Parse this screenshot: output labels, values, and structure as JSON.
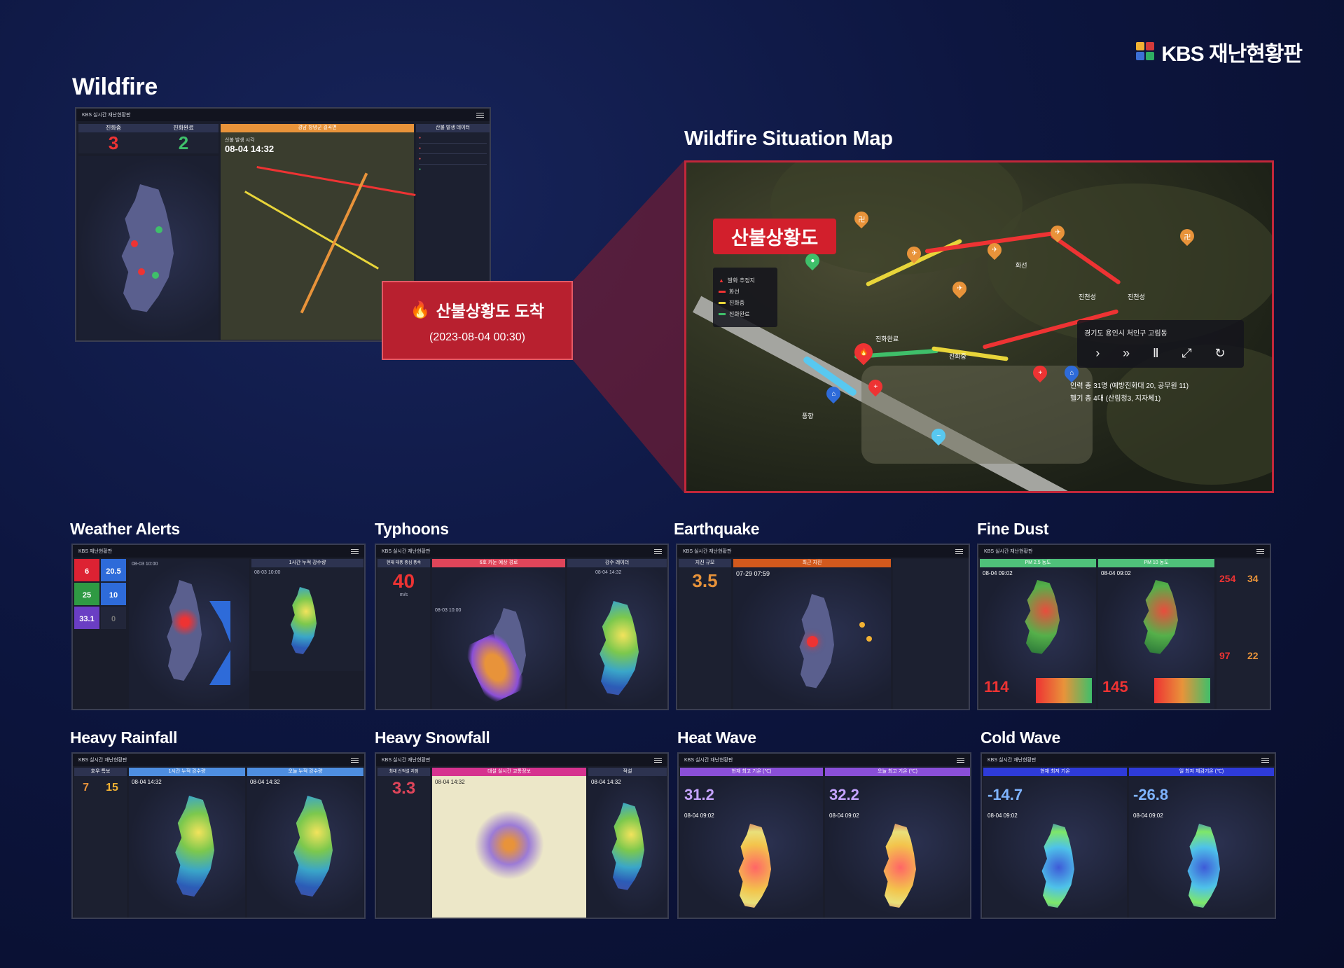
{
  "brand": {
    "name": "KBS 재난현황판"
  },
  "sections": {
    "wildfire": "Wildfire",
    "situation_map": "Wildfire Situation Map",
    "weather_alerts": "Weather Alerts",
    "typhoons": "Typhoons",
    "earthquake": "Earthquake",
    "fine_dust": "Fine Dust",
    "heavy_rainfall": "Heavy Rainfall",
    "heavy_snowfall": "Heavy Snowfall",
    "heat_wave": "Heat Wave",
    "cold_wave": "Cold Wave"
  },
  "wildfire_screen": {
    "app_title": "KBS 실시간 재난현황판",
    "in_progress_label": "진화중",
    "completed_label": "진화완료",
    "in_progress_count": "3",
    "completed_count": "2",
    "region_header": "경남 창녕군 길곡면",
    "data_header": "산불 발생 데이터",
    "occurred_label": "산불 발생 시각",
    "occurred_time": "08-04 14:32"
  },
  "callout": {
    "title": "산불상황도 도착",
    "time": "(2023-08-04 00:30)"
  },
  "situation": {
    "banner": "산불상황도",
    "legend": [
      "발화 추정지",
      "화선",
      "진화중",
      "진화완료"
    ],
    "labels": [
      "진화완료",
      "진화중",
      "진화중",
      "진천성",
      "화선",
      "진천성",
      "풍향"
    ],
    "location": "경기도 용인시 처인구 고림동",
    "personnel": "인력 총 31명 (예방진화대 20, 공무원 11)",
    "helicopters": "헬기 총 4대 (산림청3, 지자체1)"
  },
  "weather_alerts": {
    "app_title": "KBS 재난현황판",
    "time": "08-03 10:00",
    "panel_title": "1시간 누적 강수량",
    "panel_time": "08-03 10:00",
    "values": [
      "6",
      "20.5",
      "25",
      "10",
      "33.1",
      "0",
      "0",
      "0",
      "0",
      "0"
    ]
  },
  "typhoons": {
    "app_title": "KBS 실시간 재난현황판",
    "speed_label": "현재 태풍 중심 풍속",
    "speed": "40",
    "speed_unit": "m/s",
    "path_header": "6호 카눈 예상 경로",
    "time": "08-03 10:00",
    "radar_header": "강수 레이더",
    "radar_time": "08-04 14:32"
  },
  "earthquake": {
    "app_title": "KBS 실시간 재난현황판",
    "magnitude_label": "지진 규모",
    "magnitude": "3.5",
    "recent_header": "최근 지진",
    "time": "07-29 07:59"
  },
  "fine_dust": {
    "app_title": "KBS 실시간 재난현황판",
    "pm25_header": "PM 2.5 농도",
    "pm10_header": "PM 10 농도",
    "time_left": "08-04 09:02",
    "time_right": "08-04 09:02",
    "max_left": "114",
    "max_right": "145",
    "side_values": [
      "254",
      "34",
      "97",
      "22"
    ]
  },
  "heavy_rainfall": {
    "app_title": "KBS 실시간 재난현황판",
    "alert_header": "호우 특보",
    "counts": [
      "7",
      "15"
    ],
    "header_a": "1시간 누적 강수량",
    "header_b": "오늘 누적 강수량",
    "time_a": "08-04 14:32",
    "time_b": "08-04 14:32"
  },
  "heavy_snowfall": {
    "app_title": "KBS 실시간 재난현황판",
    "max_label": "최대 신적설 지점",
    "max_value": "3.3",
    "traffic_header": "대설 실시간 교통정보",
    "traffic_time": "08-04 14:32",
    "snow_header": "적설",
    "snow_time": "08-04 14:32"
  },
  "heat_wave": {
    "app_title": "KBS 실시간 재난현황판",
    "header_a": "현재 최고 기온 (℃)",
    "header_b": "오늘 최고 기온 (℃)",
    "value_a": "31.2",
    "value_b": "32.2",
    "time_a": "08-04 09:02",
    "time_b": "08-04 09:02"
  },
  "cold_wave": {
    "app_title": "KBS 실시간 재난현황판",
    "header_a": "현재 최저 기온",
    "header_b": "일 최저 체감기온 (℃)",
    "value_a": "-14.7",
    "value_b": "-26.8",
    "time_a": "08-04 09:02",
    "time_b": "08-04 09:02"
  },
  "colors": {
    "accent_red": "#c2273a",
    "orange": "#e8933a",
    "green": "#3fbf6a",
    "purple": "#8a4fd8",
    "blue": "#2e6bd9"
  }
}
